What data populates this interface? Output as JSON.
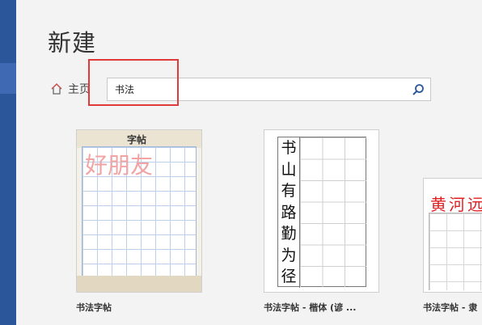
{
  "page": {
    "title": "新建"
  },
  "breadcrumb": {
    "home_label": "主页",
    "home_icon": "home-icon"
  },
  "search": {
    "value": "书法",
    "button_icon": "search-icon"
  },
  "templates": [
    {
      "caption": "书法字帖",
      "sample_chars": [
        "好",
        "朋",
        "友"
      ],
      "header_logo_text": "字帖"
    },
    {
      "caption": "书法字帖 - 楷体 (谚 ...",
      "sample_chars": [
        "书",
        "山",
        "有",
        "路",
        "勤",
        "为",
        "径"
      ]
    },
    {
      "caption": "书法字帖 - 隶",
      "sample_chars": [
        "黄",
        "河",
        "远"
      ]
    }
  ],
  "colors": {
    "accent": "#2b579a",
    "highlight": "#e03a3a",
    "red_text": "#e02020",
    "pink_text": "#f2a4a4"
  }
}
